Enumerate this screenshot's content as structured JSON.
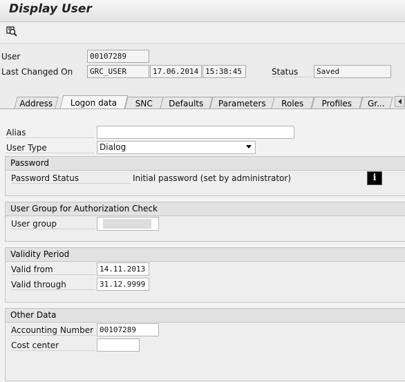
{
  "window": {
    "title": "Display User"
  },
  "toolbar": {
    "icon": "glasses-icon"
  },
  "header": {
    "user_label": "User",
    "user_value": "00107289",
    "last_changed_label": "Last Changed On",
    "last_changed_by": "GRC_USER",
    "last_changed_date": "17.06.2014",
    "last_changed_time": "15:38:45",
    "status_label": "Status",
    "status_value": "Saved"
  },
  "tabs": [
    {
      "label": "Address",
      "active": false
    },
    {
      "label": "Logon data",
      "active": true
    },
    {
      "label": "SNC",
      "active": false
    },
    {
      "label": "Defaults",
      "active": false
    },
    {
      "label": "Parameters",
      "active": false
    },
    {
      "label": "Roles",
      "active": false
    },
    {
      "label": "Profiles",
      "active": false
    },
    {
      "label": "Gr...",
      "active": false
    }
  ],
  "logon": {
    "alias_label": "Alias",
    "alias_value": "",
    "user_type_label": "User Type",
    "user_type_value": "Dialog"
  },
  "password": {
    "title": "Password",
    "status_label": "Password Status",
    "status_value": "Initial password (set by administrator)",
    "info_icon": "info-icon"
  },
  "user_group": {
    "title": "User Group for Authorization Check",
    "label": "User group",
    "value": ""
  },
  "validity": {
    "title": "Validity Period",
    "from_label": "Valid from",
    "from_value": "14.11.2013",
    "through_label": "Valid through",
    "through_value": "31.12.9999"
  },
  "other": {
    "title": "Other Data",
    "accounting_label": "Accounting Number",
    "accounting_value": "00107289",
    "cost_center_label": "Cost center",
    "cost_center_value": ""
  }
}
